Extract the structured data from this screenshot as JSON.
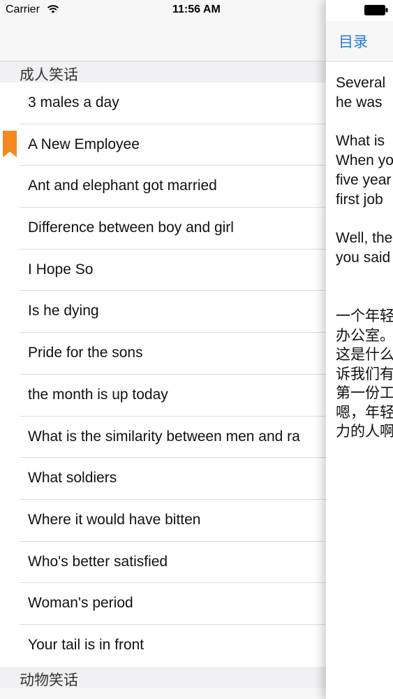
{
  "status_bar": {
    "carrier": "Carrier",
    "time": "11:56 AM"
  },
  "sections": [
    {
      "title": "成人笑话"
    },
    {
      "title": "动物笑话"
    }
  ],
  "rows": [
    {
      "label": "3 males a day",
      "bookmarked": false
    },
    {
      "label": "A New Employee",
      "bookmarked": true
    },
    {
      "label": "Ant and elephant got married",
      "bookmarked": false
    },
    {
      "label": "Difference between boy and girl",
      "bookmarked": false
    },
    {
      "label": "I Hope So",
      "bookmarked": false
    },
    {
      "label": "Is he dying",
      "bookmarked": false
    },
    {
      "label": "Pride for the sons",
      "bookmarked": false
    },
    {
      "label": "the month is up today",
      "bookmarked": false
    },
    {
      "label": "What is the similarity between men and ra",
      "bookmarked": false
    },
    {
      "label": "What soldiers",
      "bookmarked": false
    },
    {
      "label": "Where it would have bitten",
      "bookmarked": false
    },
    {
      "label": "Who's better satisfied",
      "bookmarked": false
    },
    {
      "label": "Woman's period",
      "bookmarked": false
    },
    {
      "label": "Your tail is in front",
      "bookmarked": false
    }
  ],
  "content": {
    "back_label": "目录",
    "paragraphs": [
      [
        "Several",
        "he was"
      ],
      [
        "What is",
        "When yo",
        "five year",
        "first job"
      ],
      [
        "Well, the",
        "you said"
      ]
    ],
    "zh_lines": [
      "一个年轻",
      "办公室。",
      "这是什么",
      "诉我们有",
      "第一份工",
      "嗯，年轻",
      "力的人啊"
    ]
  },
  "colors": {
    "accent": "#1a7ee6",
    "bookmark": "#f5891f"
  },
  "icons": {
    "wifi": "wifi-icon",
    "battery": "battery-icon",
    "bookmark": "bookmark-icon"
  }
}
